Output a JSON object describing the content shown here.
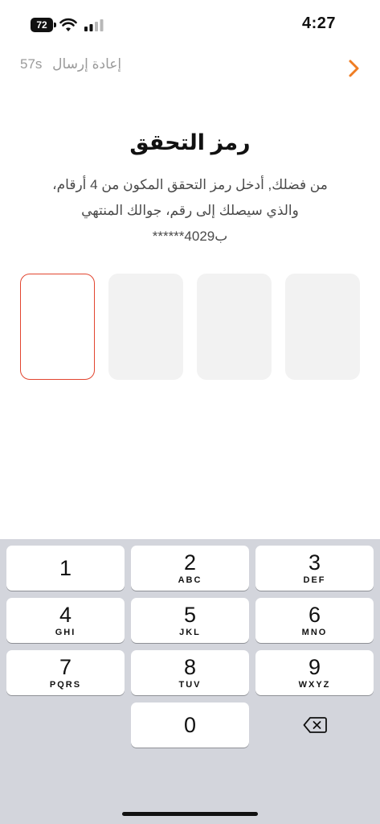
{
  "status_bar": {
    "time": "4:27",
    "battery_level": "72",
    "wifi_icon": "wifi-icon",
    "signal_icon": "cellular-signal-icon"
  },
  "header": {
    "resend_label": "إعادة إرسال",
    "resend_timer": "57s",
    "back_icon": "chevron-right-icon"
  },
  "title": "رمز التحقق",
  "description": {
    "line1": "من فضلك, أدخل رمز التحقق المكون من 4 أرقام،",
    "line2": "والذي سيصلك إلى رقم، جوالك المنتهي",
    "line3": "ب4029******"
  },
  "otp": {
    "length": 4,
    "active_index": 0
  },
  "keyboard": {
    "keys": [
      {
        "digit": "1",
        "letters": ""
      },
      {
        "digit": "2",
        "letters": "ABC"
      },
      {
        "digit": "3",
        "letters": "DEF"
      },
      {
        "digit": "4",
        "letters": "GHI"
      },
      {
        "digit": "5",
        "letters": "JKL"
      },
      {
        "digit": "6",
        "letters": "MNO"
      },
      {
        "digit": "7",
        "letters": "PQRS"
      },
      {
        "digit": "8",
        "letters": "TUV"
      },
      {
        "digit": "9",
        "letters": "WXYZ"
      },
      {
        "digit": "0",
        "letters": ""
      }
    ],
    "delete_icon": "backspace-icon"
  },
  "colors": {
    "accent": "#ef7d23",
    "active_border": "#e2452f",
    "keyboard_bg": "#d3d5dc",
    "otp_empty_bg": "#f2f2f2"
  }
}
